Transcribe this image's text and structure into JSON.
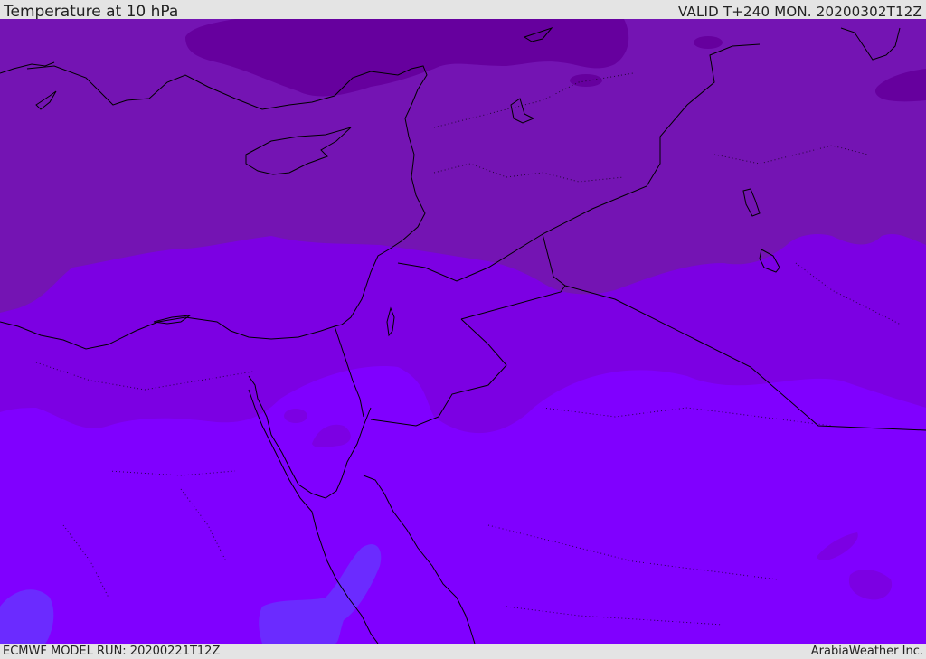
{
  "header": {
    "title": "Temperature at 10 hPa",
    "valid": "VALID T+240 MON. 20200302T12Z"
  },
  "footer": {
    "model_run": "ECMWF MODEL RUN: 20200221T12Z",
    "credit": "ArabiaWeather Inc."
  },
  "map": {
    "variable": "Temperature",
    "level": "10 hPa",
    "region": "Eastern Mediterranean / Middle East",
    "shading_colors": {
      "darkest": "#66009e",
      "dark": "#7414b3",
      "mid": "#7c00e3",
      "light": "#8000ff",
      "lightest": "#6b2bff"
    },
    "coastline_color": "#000000",
    "border_style": "dotted"
  }
}
